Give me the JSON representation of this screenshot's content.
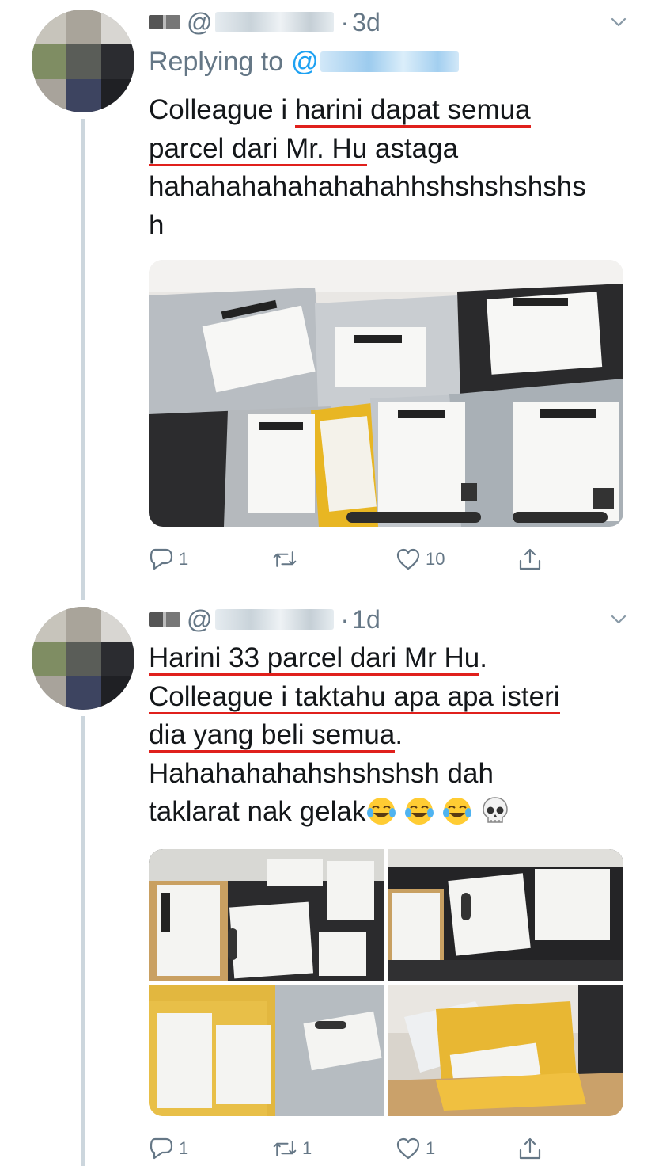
{
  "tweets": [
    {
      "handle_prefix": "@",
      "separator": "·",
      "time": "3d",
      "replying_to_label": "Replying to",
      "replying_to_prefix": "@",
      "text_lines": [
        [
          "Colleague i ",
          "harini dapat semua"
        ],
        [
          "parcel dari Mr. Hu",
          " astaga"
        ],
        [
          "hahahahahahahahahhshshshshshs",
          ""
        ],
        [
          "h",
          ""
        ]
      ],
      "stats": {
        "replies": "1",
        "retweets": "",
        "likes": "10"
      }
    },
    {
      "handle_prefix": "@",
      "separator": "·",
      "time": "1d",
      "text_lines": [
        [
          "Harini 33 parcel dari Mr Hu",
          "."
        ],
        [
          "Colleague i taktahu apa apa isteri",
          ""
        ],
        [
          "dia yang beli semua",
          "."
        ],
        [
          "Hahahahahahshshshsh dah",
          ""
        ],
        [
          "taklarat nak gelak",
          ""
        ]
      ],
      "emojis": [
        "face-with-tears-of-joy",
        "face-with-tears-of-joy",
        "face-with-tears-of-joy",
        "skull"
      ],
      "stats": {
        "replies": "1",
        "retweets": "1",
        "likes": "1"
      }
    }
  ],
  "colors": {
    "text": "#14171a",
    "muted": "#657786",
    "link": "#1da1f2",
    "underline": "#e0201c",
    "thread_line": "#ccd6dd"
  }
}
